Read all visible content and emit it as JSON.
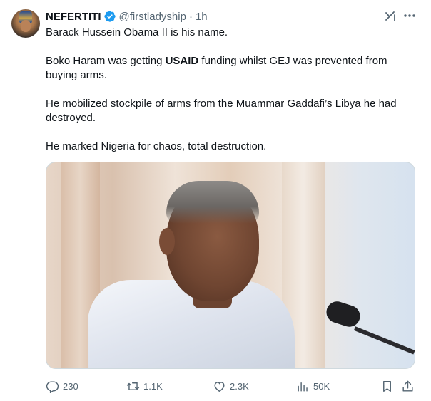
{
  "tweet": {
    "display_name": "NEFERTITI",
    "handle": "@firstladyship",
    "separator": "·",
    "time": "1h",
    "paragraphs": {
      "p1": "Barack Hussein Obama II is his name.",
      "p2_before": "Boko Haram was getting ",
      "p2_bold": "USAID",
      "p2_after": " funding whilst GEJ was prevented from buying arms.",
      "p3": "He mobilized stockpile of arms from the Muammar Gaddafi’s Libya he had destroyed.",
      "p4": "He marked Nigeria for chaos, total destruction."
    }
  },
  "actions": {
    "replies": "230",
    "retweets": "1.1K",
    "likes": "2.3K",
    "views": "50K"
  },
  "icons": {
    "verified": "verified-badge-icon",
    "grok": "grok-icon",
    "more": "more-icon",
    "reply": "reply-icon",
    "retweet": "retweet-icon",
    "like": "heart-icon",
    "views": "views-icon",
    "bookmark": "bookmark-icon",
    "share": "share-icon"
  },
  "colors": {
    "text": "#0f1419",
    "muted": "#536471",
    "verified": "#1d9bf0",
    "border": "#cfd9de"
  }
}
